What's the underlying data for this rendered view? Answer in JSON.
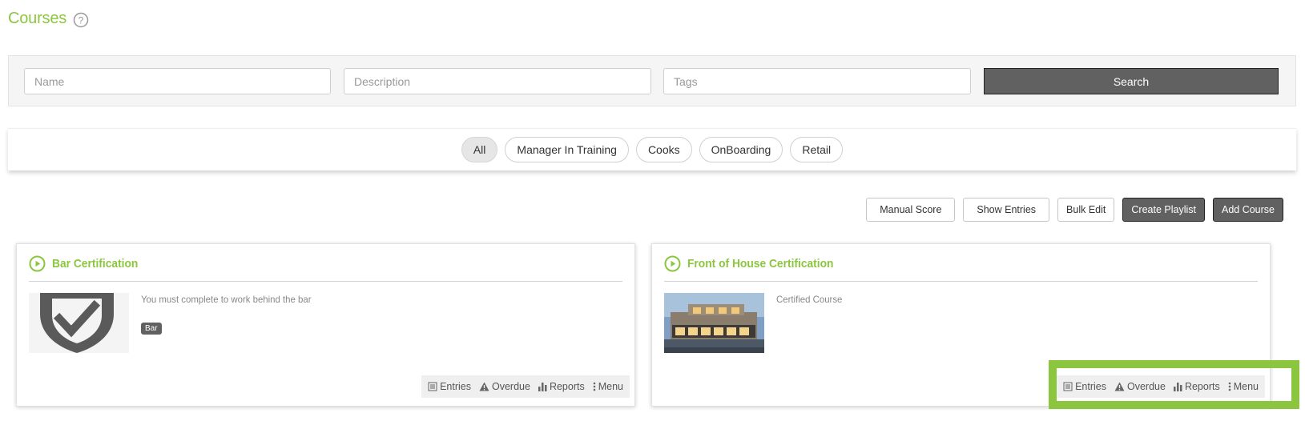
{
  "page": {
    "title": "Courses",
    "accent": "#8cc63f"
  },
  "search": {
    "name_placeholder": "Name",
    "description_placeholder": "Description",
    "tags_placeholder": "Tags",
    "button_label": "Search"
  },
  "filters": [
    "All",
    "Manager In Training",
    "Cooks",
    "OnBoarding",
    "Retail"
  ],
  "filter_selected": "All",
  "actions": {
    "manual_score": "Manual Score",
    "show_entries": "Show Entries",
    "bulk_edit": "Bulk Edit",
    "create_playlist": "Create Playlist",
    "add_course": "Add Course"
  },
  "courses": [
    {
      "title": "Bar Certification",
      "description": "You must complete to work behind the bar",
      "tag": "Bar",
      "thumbnail": "shield-check-icon"
    },
    {
      "title": "Front of House Certification",
      "description": "Certified Course",
      "thumbnail": "building-photo"
    }
  ],
  "card_footer": {
    "entries": "Entries",
    "overdue": "Overdue",
    "reports": "Reports",
    "menu": "Menu"
  }
}
